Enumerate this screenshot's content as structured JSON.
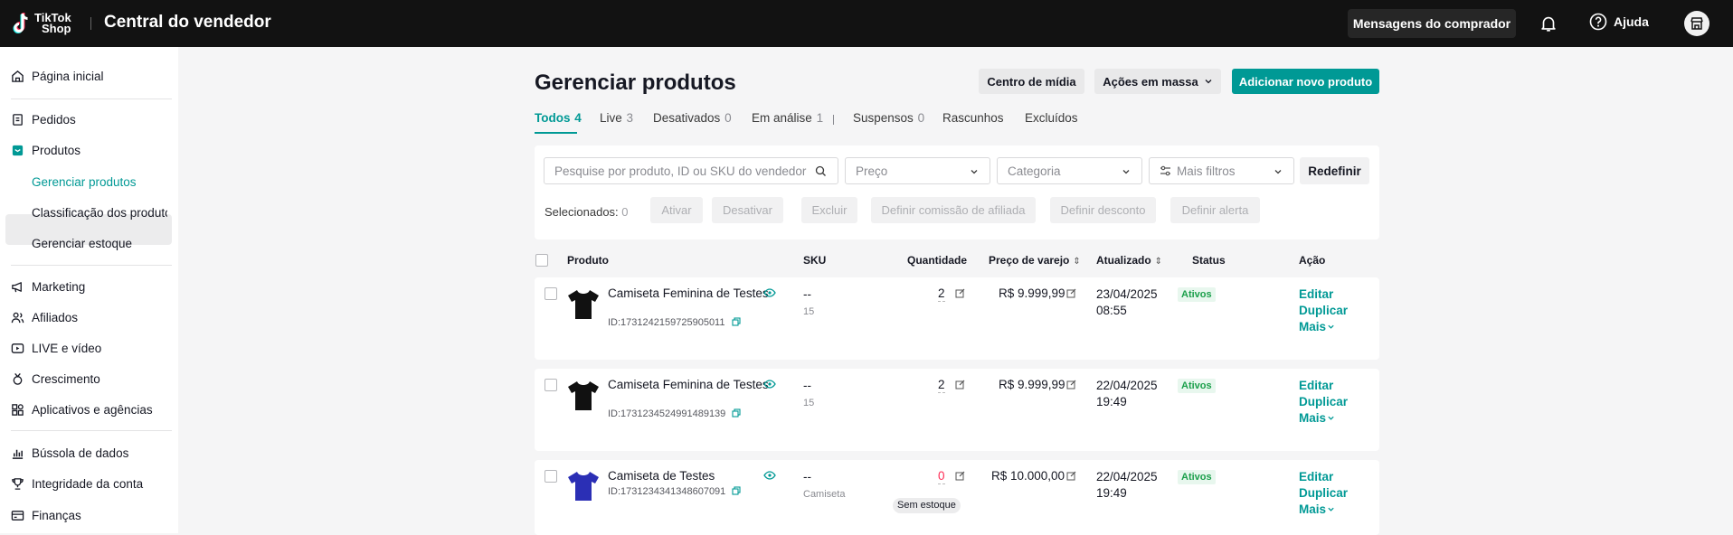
{
  "topbar": {
    "logo_line1": "TikTok",
    "logo_line2": "Shop",
    "app_title": "Central do vendedor",
    "messages_button": "Mensagens do comprador",
    "help_label": "Ajuda"
  },
  "sidebar": {
    "home": "Página inicial",
    "orders": "Pedidos",
    "products": "Produtos",
    "products_sub": [
      "Gerenciar produtos",
      "Classificação dos produtos",
      "Gerenciar estoque"
    ],
    "marketing": "Marketing",
    "affiliates": "Afiliados",
    "live": "LIVE e vídeo",
    "growth": "Crescimento",
    "apps": "Aplicativos e agências",
    "data_compass": "Bússola de dados",
    "account_health": "Integridade da conta",
    "finance": "Finanças"
  },
  "page": {
    "title": "Gerenciar produtos",
    "media_center": "Centro de mídia",
    "bulk_actions": "Ações em massa",
    "add_product": "Adicionar novo produto"
  },
  "tabs": [
    {
      "label": "Todos",
      "count": "4"
    },
    {
      "label": "Live",
      "count": "3"
    },
    {
      "label": "Desativados",
      "count": "0"
    },
    {
      "label": "Em análise",
      "count": "1"
    },
    {
      "label": "Suspensos",
      "count": "0"
    },
    {
      "label": "Rascunhos",
      "count": ""
    },
    {
      "label": "Excluídos",
      "count": ""
    }
  ],
  "filters": {
    "search_placeholder": "Pesquise por produto, ID ou SKU do vendedor",
    "price": "Preço",
    "category": "Categoria",
    "more_filters": "Mais filtros",
    "reset": "Redefinir",
    "selected_label": "Selecionados:",
    "selected_count": "0",
    "actions": [
      "Ativar",
      "Desativar",
      "Excluir",
      "Definir comissão de afiliada",
      "Definir desconto",
      "Definir alerta"
    ]
  },
  "table": {
    "headers": {
      "product": "Produto",
      "sku": "SKU",
      "quantity": "Quantidade",
      "price": "Preço de varejo",
      "updated": "Atualizado",
      "status": "Status",
      "action": "Ação"
    },
    "rows": [
      {
        "name": "Camiseta Feminina de Testes",
        "id": "ID:1731242159725905011",
        "sku": "--",
        "sku_sub": "15",
        "quantity": "2",
        "price": "R$ 9.999,99",
        "updated_date": "23/04/2025",
        "updated_time": "08:55",
        "status": "Ativos",
        "edit": "Editar",
        "duplicate": "Duplicar",
        "more": "Mais",
        "stock_note": ""
      },
      {
        "name": "Camiseta Feminina de Testes",
        "id": "ID:1731234524991489139",
        "sku": "--",
        "sku_sub": "15",
        "quantity": "2",
        "price": "R$ 9.999,99",
        "updated_date": "22/04/2025",
        "updated_time": "19:49",
        "status": "Ativos",
        "edit": "Editar",
        "duplicate": "Duplicar",
        "more": "Mais",
        "stock_note": ""
      },
      {
        "name": "Camiseta de Testes",
        "id": "ID:1731234341348607091",
        "sku": "--",
        "sku_sub": "Camiseta",
        "quantity": "0",
        "price": "R$ 10.000,00",
        "updated_date": "22/04/2025",
        "updated_time": "19:49",
        "status": "Ativos",
        "edit": "Editar",
        "duplicate": "Duplicar",
        "more": "Mais",
        "stock_note": "Sem estoque"
      }
    ]
  },
  "colors": {
    "accent": "#009995",
    "topbar": "#121212",
    "status_green": "#1a9f4a",
    "out_of_stock": "#fe2c55",
    "shirt_black": "#111111",
    "shirt_blue": "#2b2fb5"
  },
  "icons": [
    "tiktok-logo-icon",
    "bell-icon",
    "help-icon",
    "store-icon",
    "home-icon",
    "orders-icon",
    "products-icon",
    "megaphone-icon",
    "affiliates-icon",
    "live-icon",
    "growth-icon",
    "apps-icon",
    "data-icon",
    "trophy-icon",
    "finance-icon",
    "search-icon",
    "chevron-down-icon",
    "filter-icon",
    "eye-icon",
    "copy-icon",
    "edit-icon",
    "sort-icon"
  ]
}
